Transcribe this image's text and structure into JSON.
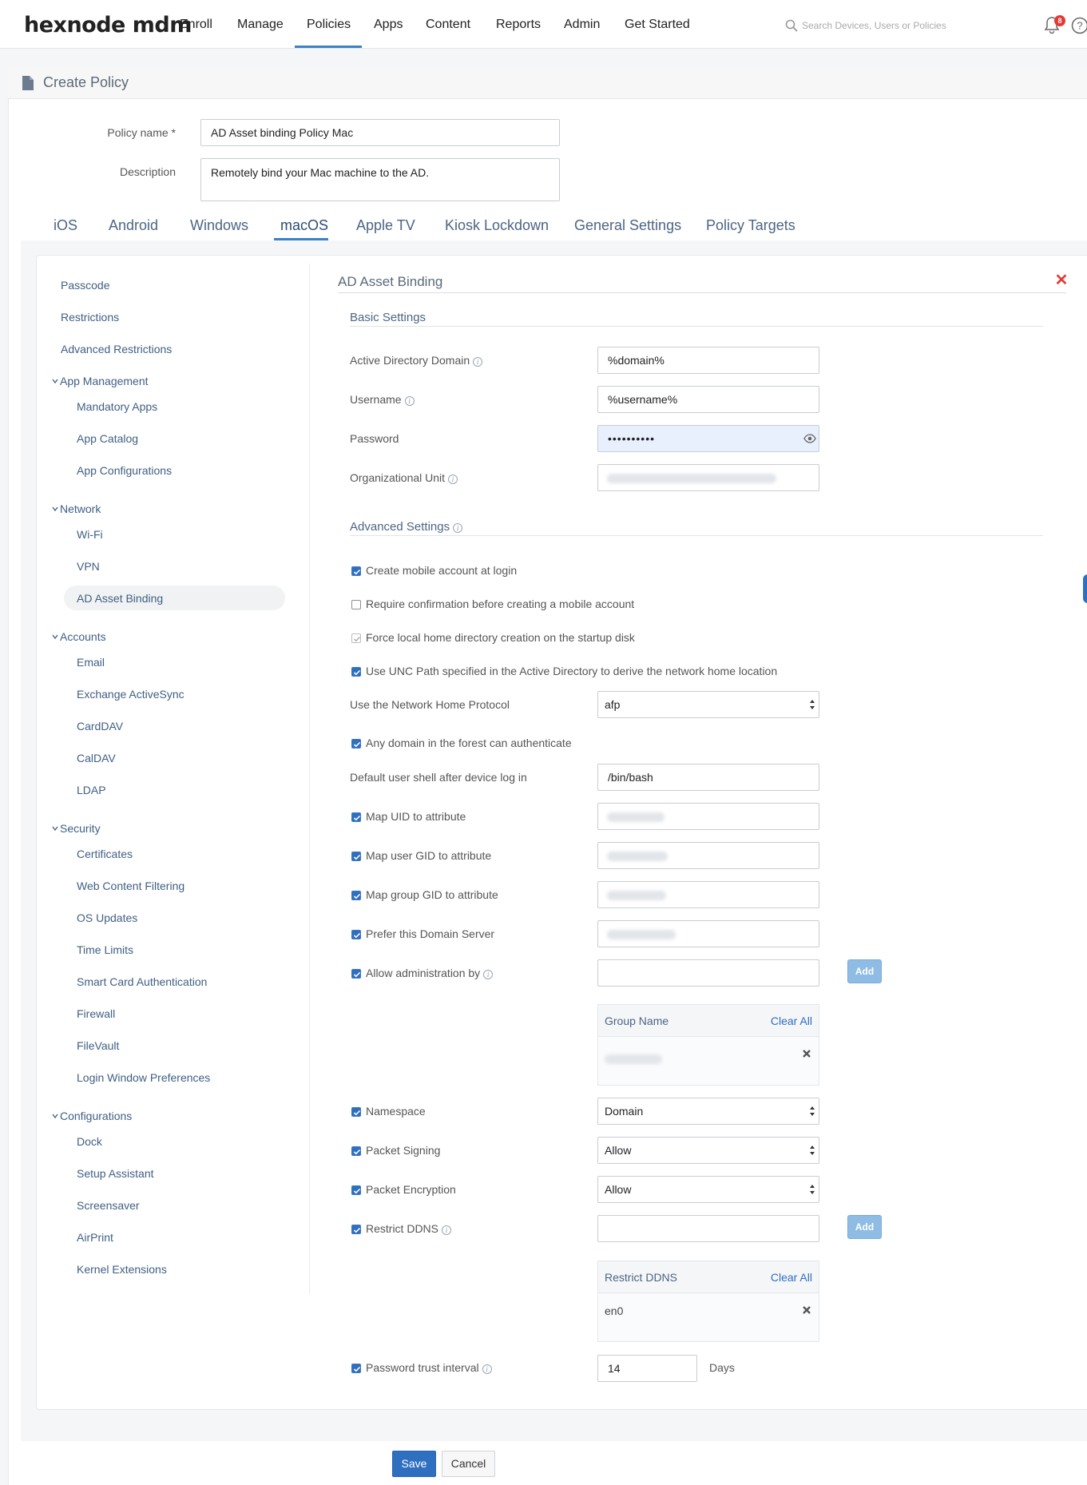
{
  "app": {
    "logo": "hexnode mdm"
  },
  "nav": {
    "items": [
      "Enroll",
      "Manage",
      "Policies",
      "Apps",
      "Content",
      "Reports",
      "Admin",
      "Get Started"
    ],
    "active": "Policies"
  },
  "search": {
    "placeholder": "Search Devices, Users or Policies"
  },
  "notifications": {
    "count": "8"
  },
  "page": {
    "title": "Create Policy"
  },
  "policy_form": {
    "name_label": "Policy name *",
    "name_value": "AD Asset binding Policy Mac",
    "description_label": "Description",
    "description_value": "Remotely bind your Mac machine to the AD."
  },
  "tabs": [
    "iOS",
    "Android",
    "Windows",
    "macOS",
    "Apple TV",
    "Kiosk Lockdown",
    "General Settings",
    "Policy Targets"
  ],
  "active_tab": "macOS",
  "sidebar": {
    "items": {
      "passcode": "Passcode",
      "restrictions": "Restrictions",
      "advanced_restrictions": "Advanced Restrictions",
      "app_management": "App Management",
      "mandatory_apps": "Mandatory Apps",
      "app_catalog": "App Catalog",
      "app_configurations": "App Configurations",
      "network": "Network",
      "wifi": "Wi-Fi",
      "vpn": "VPN",
      "ad_asset_binding": "AD Asset Binding",
      "accounts": "Accounts",
      "email": "Email",
      "exchange": "Exchange ActiveSync",
      "carddav": "CardDAV",
      "caldav": "CalDAV",
      "ldap": "LDAP",
      "security": "Security",
      "certificates": "Certificates",
      "web_content": "Web Content Filtering",
      "os_updates": "OS Updates",
      "time_limits": "Time Limits",
      "smart_card": "Smart Card Authentication",
      "firewall": "Firewall",
      "filevault": "FileVault",
      "login_window": "Login Window Preferences",
      "configurations": "Configurations",
      "dock": "Dock",
      "setup_assistant": "Setup Assistant",
      "screensaver": "Screensaver",
      "airprint": "AirPrint",
      "kernel_extensions": "Kernel Extensions"
    },
    "selected": "AD Asset Binding"
  },
  "section": {
    "title": "AD Asset Binding",
    "basic_settings": "Basic Settings",
    "advanced_settings": "Advanced Settings"
  },
  "basic": {
    "ad_domain_label": "Active Directory Domain",
    "ad_domain_value": "%domain%",
    "username_label": "Username",
    "username_value": "%username%",
    "password_label": "Password",
    "password_mask": "••••••••••",
    "ou_label": "Organizational Unit"
  },
  "advanced": {
    "create_mobile_account": "Create mobile account at login",
    "require_confirmation": "Require confirmation before creating a mobile account",
    "force_local_home": "Force local home directory creation on the startup disk",
    "use_unc_path": "Use UNC Path specified in the Active Directory to derive the network home location",
    "network_protocol_label": "Use the Network Home Protocol",
    "network_protocol_value": "afp",
    "any_domain": "Any domain in the forest can authenticate",
    "default_shell_label": "Default user shell after device log in",
    "default_shell_value": "/bin/bash",
    "map_uid": "Map UID to attribute",
    "map_user_gid": "Map user GID to attribute",
    "map_group_gid": "Map group GID to attribute",
    "prefer_domain_server": "Prefer this Domain Server",
    "allow_admin": "Allow administration by",
    "add_label": "Add",
    "group_name_header": "Group Name",
    "clear_all": "Clear All",
    "namespace_label": "Namespace",
    "namespace_value": "Domain",
    "packet_signing_label": "Packet Signing",
    "packet_signing_value": "Allow",
    "packet_encryption_label": "Packet Encryption",
    "packet_encryption_value": "Allow",
    "restrict_ddns_label": "Restrict DDNS",
    "restrict_ddns_header": "Restrict DDNS",
    "restrict_ddns_entry": "en0",
    "password_trust_label": "Password trust interval",
    "password_trust_value": "14",
    "days_label": "Days"
  },
  "footer": {
    "save": "Save",
    "cancel": "Cancel"
  },
  "colors": {
    "accent": "#2f6fc0",
    "nav_underline": "#3b82c4",
    "close": "#e53935"
  },
  "icons": [
    "search-icon",
    "bell-icon",
    "help-icon",
    "doc-icon",
    "info-icon",
    "close-icon",
    "eye-icon",
    "chevron-down-icon",
    "checkbox-icon",
    "remove-icon",
    "select-arrows-icon"
  ]
}
